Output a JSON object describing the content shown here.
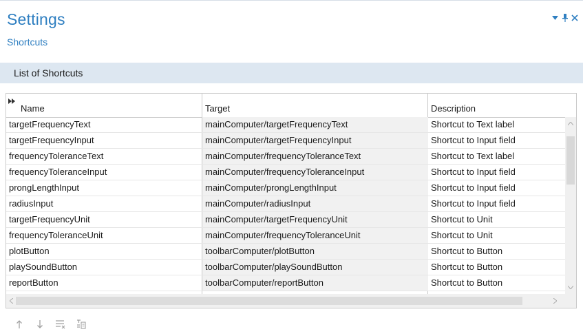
{
  "window": {
    "title": "Settings",
    "subtitle": "Shortcuts"
  },
  "section": {
    "header": "List of Shortcuts"
  },
  "table": {
    "columns": [
      "Name",
      "Target",
      "Description"
    ],
    "rows": [
      {
        "name": "targetFrequencyText",
        "target": "mainComputer/targetFrequencyText",
        "description": "Shortcut to Text label"
      },
      {
        "name": "targetFrequencyInput",
        "target": "mainComputer/targetFrequencyInput",
        "description": "Shortcut to Input field"
      },
      {
        "name": "frequencyToleranceText",
        "target": "mainComputer/frequencyToleranceText",
        "description": "Shortcut to Text label"
      },
      {
        "name": "frequencyToleranceInput",
        "target": "mainComputer/frequencyToleranceInput",
        "description": "Shortcut to Input field"
      },
      {
        "name": "prongLengthInput",
        "target": "mainComputer/prongLengthInput",
        "description": "Shortcut to Input field"
      },
      {
        "name": "radiusInput",
        "target": "mainComputer/radiusInput",
        "description": "Shortcut to Input field"
      },
      {
        "name": "targetFrequencyUnit",
        "target": "mainComputer/targetFrequencyUnit",
        "description": "Shortcut to Unit"
      },
      {
        "name": "frequencyToleranceUnit",
        "target": "mainComputer/frequencyToleranceUnit",
        "description": "Shortcut to Unit"
      },
      {
        "name": "plotButton",
        "target": "toolbarComputer/plotButton",
        "description": "Shortcut to Button"
      },
      {
        "name": "playSoundButton",
        "target": "toolbarComputer/playSoundButton",
        "description": "Shortcut to Button"
      },
      {
        "name": "reportButton",
        "target": "toolbarComputer/reportButton",
        "description": "Shortcut to Button"
      }
    ]
  },
  "toolbar": {
    "icons": [
      "move-up-icon",
      "move-down-icon",
      "clear-list-icon",
      "add-from-selection-icon"
    ]
  },
  "colors": {
    "accent": "#2f7fc1",
    "section_header_bg": "#dde7f1",
    "target_column_bg": "#f1f1f1",
    "grid_border": "#c9c9c9"
  }
}
